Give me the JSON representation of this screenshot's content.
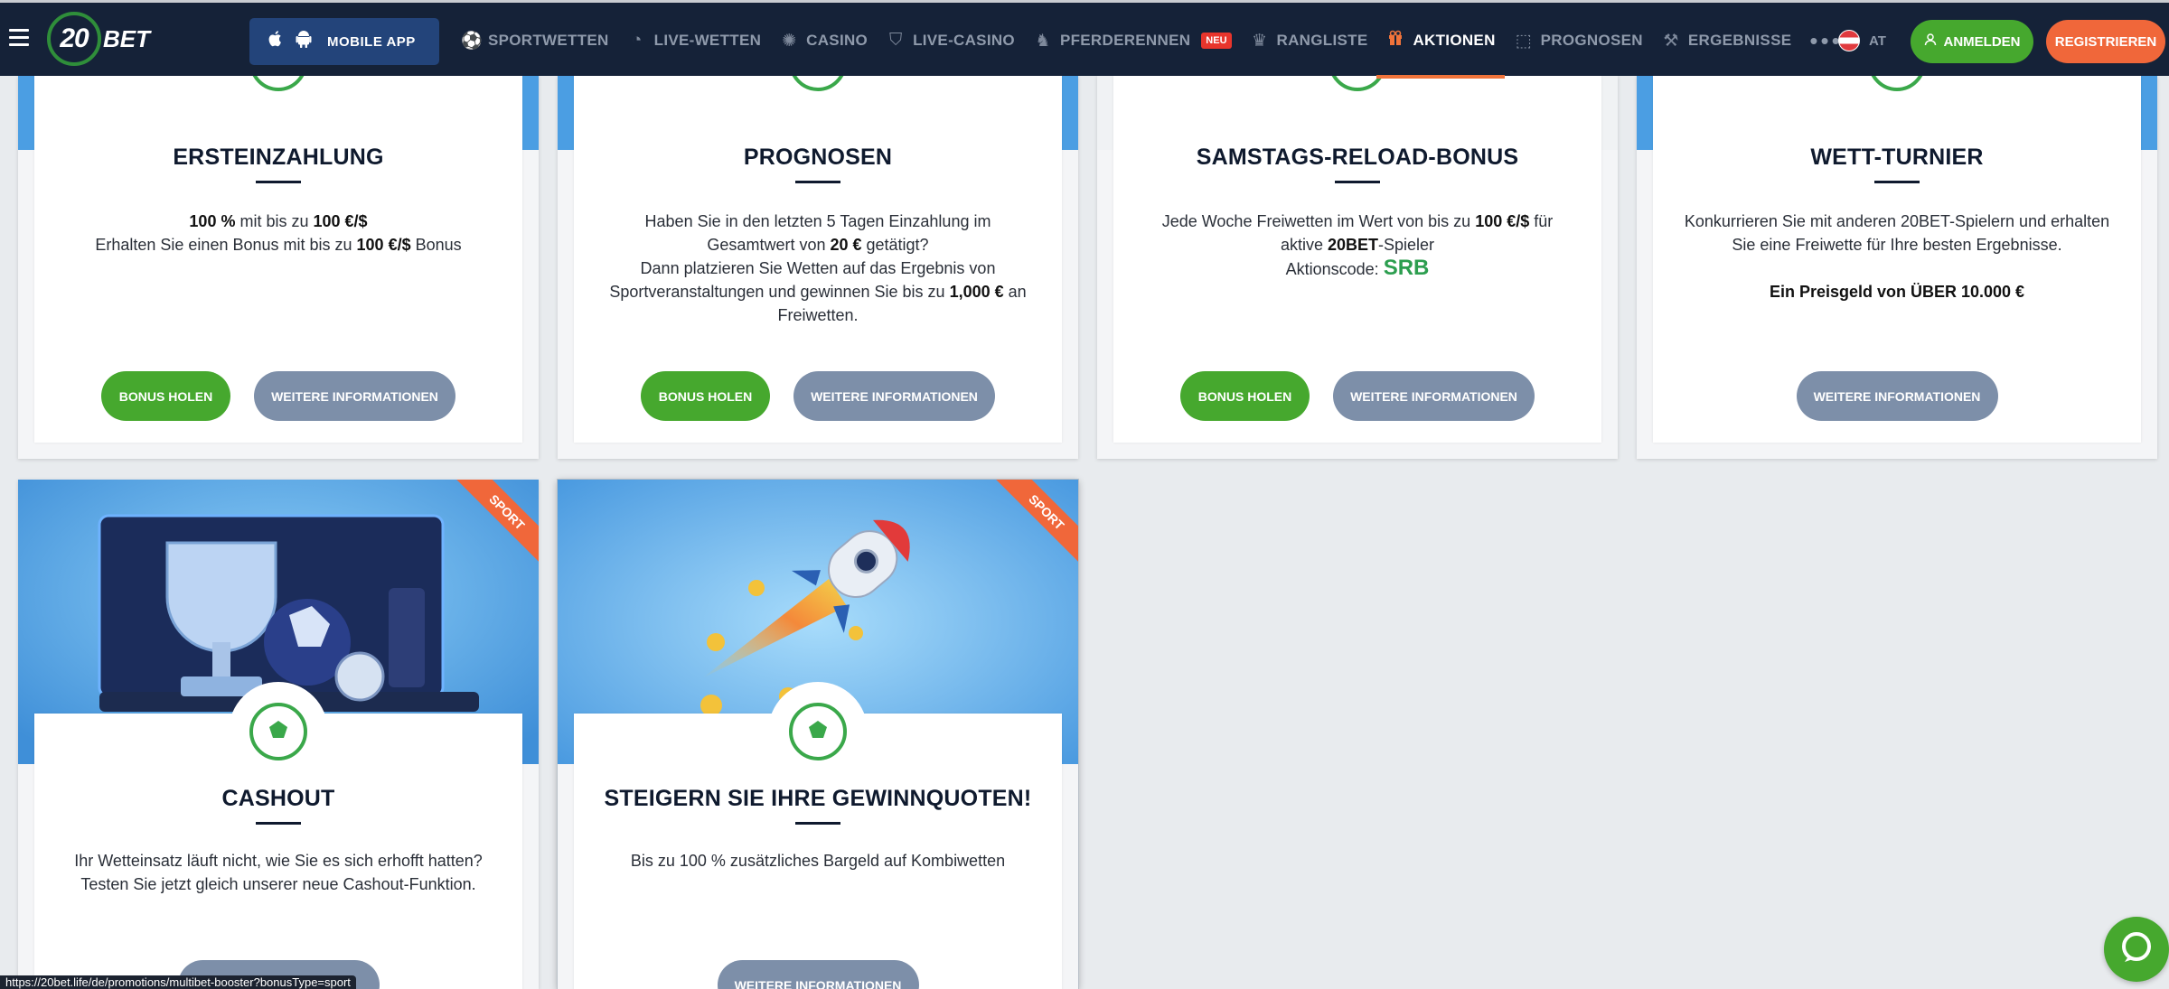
{
  "header": {
    "logo_number": "20",
    "logo_text": "BET",
    "mobile_app_label": "MOBILE APP",
    "nav": [
      {
        "label": "SPORTWETTEN",
        "icon": "soccer-ball-icon"
      },
      {
        "label": "LIVE-WETTEN",
        "icon": "live-icon"
      },
      {
        "label": "CASINO",
        "icon": "casino-chip-icon"
      },
      {
        "label": "LIVE-CASINO",
        "icon": "card-icon"
      },
      {
        "label": "PFERDERENNEN",
        "icon": "horse-icon",
        "badge": "NEU"
      },
      {
        "label": "RANGLISTE",
        "icon": "trophy-icon"
      },
      {
        "label": "AKTIONEN",
        "icon": "gift-icon",
        "active": true
      },
      {
        "label": "PROGNOSEN",
        "icon": "cursor-icon"
      },
      {
        "label": "ERGEBNISSE",
        "icon": "tools-icon"
      }
    ],
    "more_label": "•••",
    "lang_label": "AT",
    "login_label": "ANMELDEN",
    "register_label": "REGISTRIEREN"
  },
  "cards_row1": [
    {
      "title": "ERSTEINZAHLUNG",
      "desc_html": "<b>100 %</b> mit bis zu <b>100 €/$</b><br>Erhalten Sie einen Bonus mit bis zu <b>100 €/$</b> Bonus",
      "bonus_label": "BONUS HOLEN",
      "info_label": "WEITERE INFORMATIONEN"
    },
    {
      "title": "PROGNOSEN",
      "desc_html": "Haben Sie in den letzten 5 Tagen Einzahlung im Gesamtwert von <b>20 €</b> getätigt?<br>Dann platzieren Sie Wetten auf das Ergebnis von Sportveranstaltungen und gewinnen Sie bis zu <b>1,000 €</b> an Freiwetten.",
      "bonus_label": "BONUS HOLEN",
      "info_label": "WEITERE INFORMATIONEN"
    },
    {
      "title": "SAMSTAGS-RELOAD-BONUS",
      "desc_html": "Jede Woche Freiwetten im Wert von bis zu <b>100 €/$</b> für aktive <b>20BET</b>-Spieler<br>Aktionscode: <span class=\"promo-code\">SRB</span>",
      "bonus_label": "BONUS HOLEN",
      "info_label": "WEITERE INFORMATIONEN"
    },
    {
      "title": "WETT-TURNIER",
      "desc_html": "Konkurrieren Sie mit anderen 20BET-Spielern und erhalten Sie eine Freiwette für Ihre besten Ergebnisse.<br><br><b>Ein Preisgeld von ÜBER 10.000 €</b>",
      "info_label": "WEITERE INFORMATIONEN"
    }
  ],
  "cards_row2": [
    {
      "title": "CASHOUT",
      "ribbon": "SPORT",
      "desc_html": "Ihr Wetteinsatz läuft nicht, wie Sie es sich erhofft hatten?<br>Testen Sie jetzt gleich unserer neue Cashout-Funktion."
    },
    {
      "title": "STEIGERN SIE IHRE GEWINNQUOTEN!",
      "ribbon": "SPORT",
      "desc_html": "Bis zu 100 % zusätzliches Bargeld auf Kombiwetten",
      "info_label": "WEITERE INFORMATIONEN"
    }
  ],
  "status_url": "https://20bet.life/de/promotions/multibet-booster?bonusType=sport",
  "colors": {
    "brand_green": "#46a82e",
    "brand_orange": "#f0673a",
    "header_bg": "#152238",
    "info_button": "#7d8fa9"
  }
}
